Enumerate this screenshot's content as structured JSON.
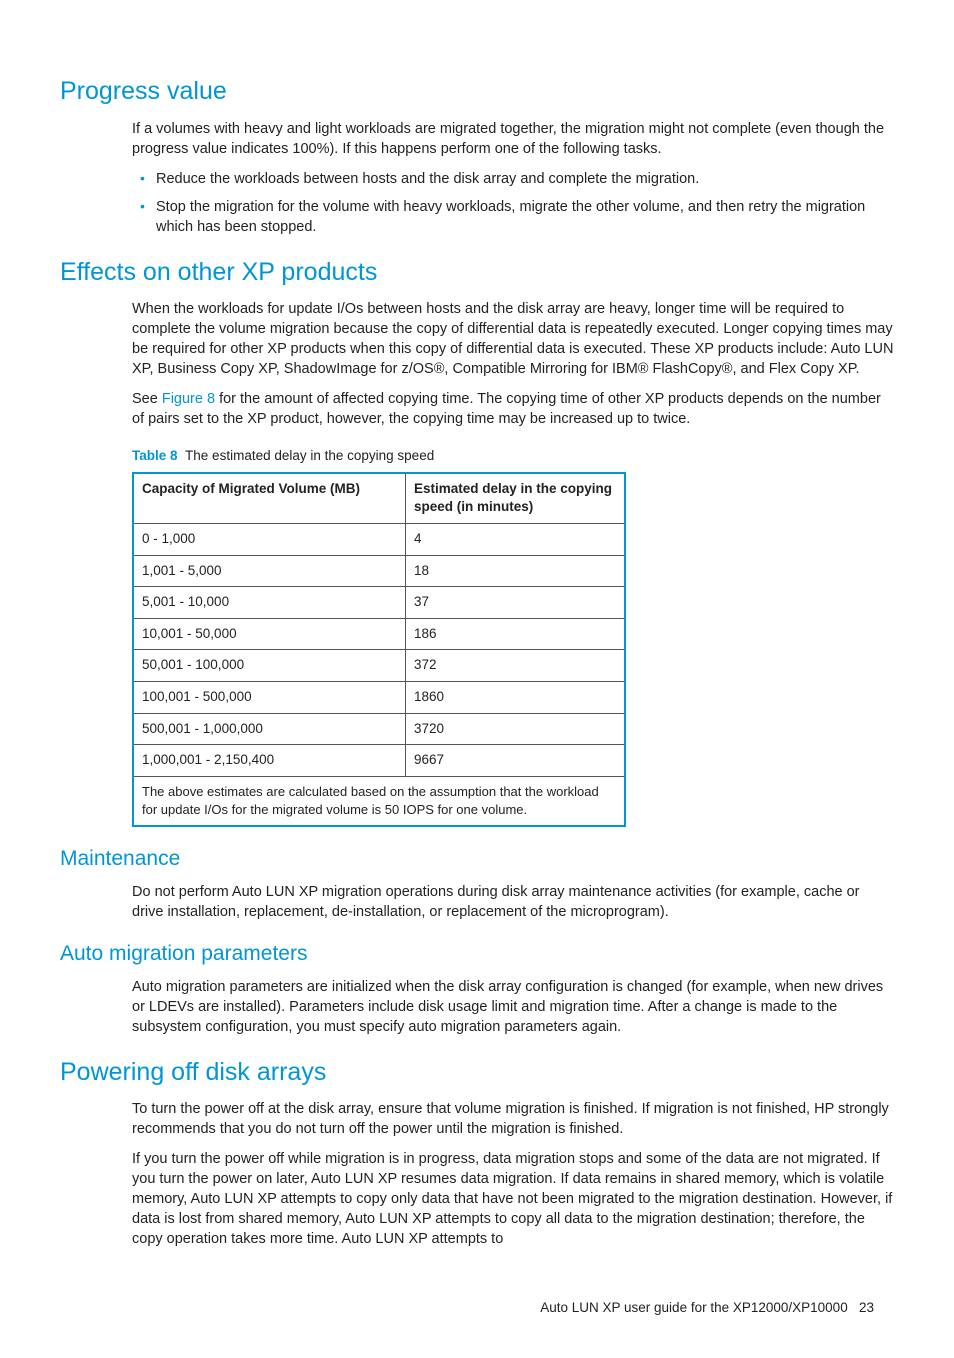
{
  "section1": {
    "heading": "Progress value",
    "para": "If a volumes with heavy and light workloads are migrated together, the migration might not complete (even though the progress value indicates 100%). If this happens perform one of the following tasks.",
    "bullets": [
      "Reduce the workloads between hosts and the disk array and complete the migration.",
      "Stop the migration for the volume with heavy workloads, migrate the other volume, and then retry the migration which has been stopped."
    ]
  },
  "section2": {
    "heading": "Effects on other XP products",
    "para1": "When the workloads for update I/Os between hosts and the disk array are heavy, longer time will be required to complete the volume migration because the copy of differential data is repeatedly executed. Longer copying times may be required for other XP products when this copy of differential data is executed. These XP products include: Auto LUN XP, Business Copy XP, ShadowImage for z/OS®, Compatible Mirroring for IBM® FlashCopy®, and Flex Copy XP.",
    "para2_pre": "See ",
    "para2_link": "Figure 8",
    "para2_post": " for the amount of affected copying time. The copying time of other XP products depends on the number of pairs set to the XP product, however, the copying time may be increased up to twice.",
    "table": {
      "caption_label": "Table 8",
      "caption_text": "The estimated delay in the copying speed",
      "headers": [
        "Capacity of Migrated Volume (MB)",
        "Estimated delay in the copying speed (in minutes)"
      ],
      "rows": [
        [
          "0 - 1,000",
          "4"
        ],
        [
          "1,001 - 5,000",
          "18"
        ],
        [
          "5,001 - 10,000",
          "37"
        ],
        [
          "10,001 - 50,000",
          "186"
        ],
        [
          "50,001 - 100,000",
          "372"
        ],
        [
          "100,001 - 500,000",
          "1860"
        ],
        [
          "500,001 - 1,000,000",
          "3720"
        ],
        [
          "1,000,001 - 2,150,400",
          "9667"
        ]
      ],
      "footnote": "The above estimates are calculated based on the assumption that the workload for update I/Os for the migrated volume is 50 IOPS for one volume."
    }
  },
  "section3": {
    "heading": "Maintenance",
    "para": "Do not perform Auto LUN XP migration operations during disk array maintenance activities (for example, cache or drive installation, replacement, de-installation, or replacement of the microprogram)."
  },
  "section4": {
    "heading": "Auto migration parameters",
    "para": "Auto migration parameters are initialized when the disk array configuration is changed (for example, when new drives or LDEVs are installed). Parameters include disk usage limit and migration time. After a change is made to the subsystem configuration, you must specify auto migration parameters again."
  },
  "section5": {
    "heading": "Powering off disk arrays",
    "para1": "To turn the power off at the disk array, ensure that volume migration is finished. If migration is not finished, HP strongly recommends that you do not turn off the power until the migration is finished.",
    "para2": "If you turn the power off while migration is in progress, data migration stops and some of the data are not migrated. If you turn the power on later, Auto LUN XP resumes data migration. If data remains in shared memory, which is volatile memory, Auto LUN XP attempts to copy only data that have not been migrated to the migration destination. However, if data is lost from shared memory, Auto LUN XP attempts to copy all data to the migration destination; therefore, the copy operation takes more time. Auto LUN XP attempts to"
  },
  "footer": {
    "text": "Auto LUN XP user guide for the XP12000/XP10000",
    "page": "23"
  }
}
